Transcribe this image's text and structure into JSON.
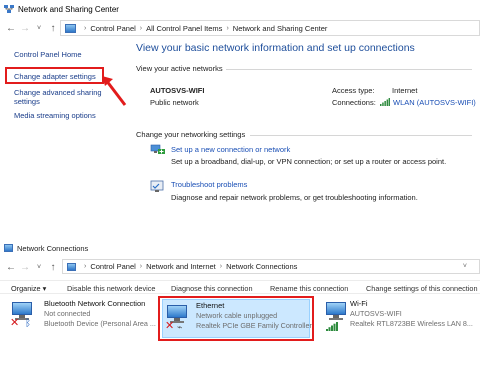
{
  "top_window": {
    "title": "Network and Sharing Center",
    "breadcrumb": [
      "Control Panel",
      "All Control Panel Items",
      "Network and Sharing Center"
    ],
    "sidebar": {
      "home": "Control Panel Home",
      "items": [
        "Change adapter settings",
        "Change advanced sharing settings",
        "Media streaming options"
      ],
      "highlighted": "Change adapter settings"
    },
    "main": {
      "heading": "View your basic network information and set up connections",
      "active_networks_label": "View your active networks",
      "network_name": "AUTOSVS-WIFI",
      "network_type": "Public network",
      "access_type_label": "Access type:",
      "access_type_value": "Internet",
      "connections_label": "Connections:",
      "connections_value": "WLAN (AUTOSVS-WIFI)",
      "change_settings_label": "Change your networking settings",
      "tasks": [
        {
          "link": "Set up a new connection or network",
          "desc": "Set up a broadband, dial-up, or VPN connection; or set up a router or access point."
        },
        {
          "link": "Troubleshoot problems",
          "desc": "Diagnose and repair network problems, or get troubleshooting information."
        }
      ]
    }
  },
  "bottom_window": {
    "title": "Network Connections",
    "breadcrumb": [
      "Control Panel",
      "Network and Internet",
      "Network Connections"
    ],
    "toolbar": [
      "Organize ▾",
      "Disable this network device",
      "Diagnose this connection",
      "Rename this connection",
      "Change settings of this connection"
    ],
    "adapters": [
      {
        "name": "Bluetooth Network Connection",
        "status": "Not connected",
        "device": "Bluetooth Device (Personal Area ..."
      },
      {
        "name": "Ethernet",
        "status": "Network cable unplugged",
        "device": "Realtek PCIe GBE Family Controller"
      },
      {
        "name": "Wi-Fi",
        "status": "AUTOSVS-WIFI",
        "device": "Realtek RTL8723BE Wireless LAN 8..."
      }
    ]
  },
  "colors": {
    "accent": "#1e4e9b",
    "link": "#1a4fb5",
    "highlight_red": "#e21c1c",
    "selection": "#cce8ff"
  }
}
